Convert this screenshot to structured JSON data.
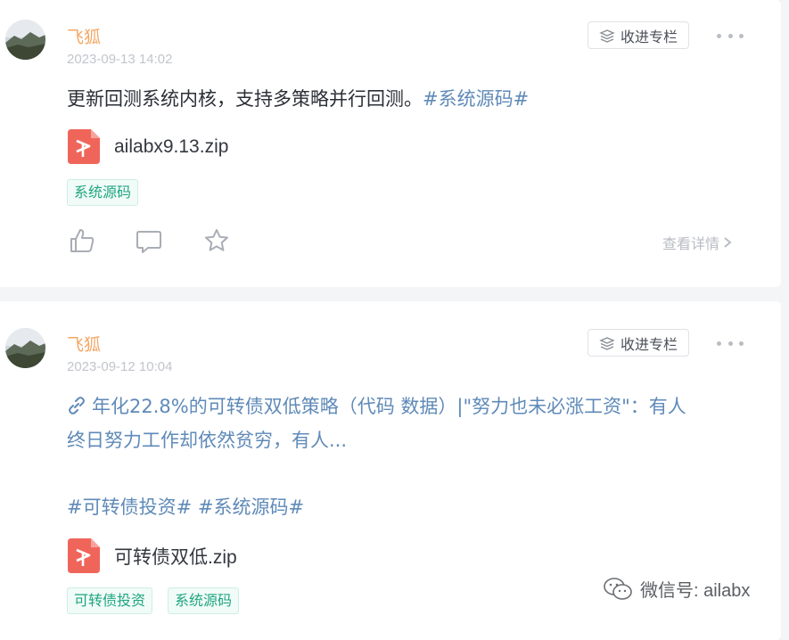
{
  "posts": [
    {
      "author": "飞狐",
      "timestamp": "2023-09-13 14:02",
      "collect_label": "收进专栏",
      "text": "更新回测系统内核，支持多策略并行回测。",
      "hashtag": "#系统源码#",
      "file_name": "ailabx9.13.zip",
      "tags": [
        "系统源码"
      ],
      "details_label": "查看详情"
    },
    {
      "author": "飞狐",
      "timestamp": "2023-09-12 10:04",
      "collect_label": "收进专栏",
      "link_line1": "年化22.8%的可转债双低策略（代码 数据）|\"努力也未必涨工资\"：有人",
      "link_line2": "终日努力工作却依然贫穷，有人...",
      "hashtags": "#可转债投资# #系统源码#",
      "file_name": "可转债双低.zip",
      "tags": [
        "可转债投资",
        "系统源码"
      ]
    }
  ],
  "watermark": "微信号: ailabx",
  "colors": {
    "author": "#f4a765",
    "hashtag": "#5f8ab8",
    "tag_text": "#1fa67f",
    "file_icon": "#f0655a"
  },
  "icons": [
    "collect-icon",
    "more-icon",
    "zip-file-icon",
    "like-icon",
    "comment-icon",
    "star-icon",
    "chevron-right-icon",
    "link-icon",
    "wechat-icon"
  ]
}
